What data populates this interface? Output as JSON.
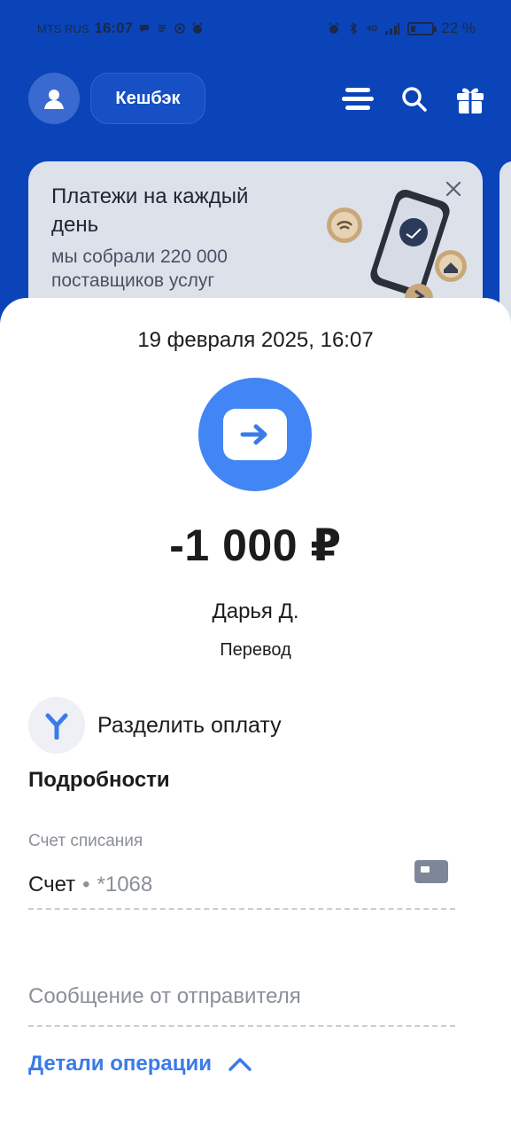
{
  "status_bar": {
    "carrier": "MTS RUS",
    "time": "16:07",
    "network": "4G",
    "battery_level": 0.22,
    "battery_text": "22 %"
  },
  "header": {
    "cashback_label": "Кешбэк",
    "icons": [
      "profile-icon",
      "menu-icon",
      "search-icon",
      "gift-icon"
    ]
  },
  "promo": {
    "title": "Платежи на каждый день",
    "subtitle": "мы собрали 220 000 поставщиков услуг"
  },
  "transaction": {
    "date": "19 февраля 2025, 16:07",
    "amount": "-1 000 ₽",
    "recipient": "Дарья Д.",
    "type": "Перевод",
    "icon": "transfer-arrow-icon"
  },
  "actions": {
    "split_label": "Разделить оплату"
  },
  "details": {
    "heading": "Подробности",
    "account_label": "Счет списания",
    "account_name": "Счет",
    "account_separator": "•",
    "account_number": "*1068",
    "message_placeholder": "Сообщение от отправителя",
    "operation_details_label": "Детали операции"
  },
  "colors": {
    "brand_blue": "#0a44b8",
    "accent_blue": "#4285f4",
    "link_blue": "#3b7be8"
  }
}
